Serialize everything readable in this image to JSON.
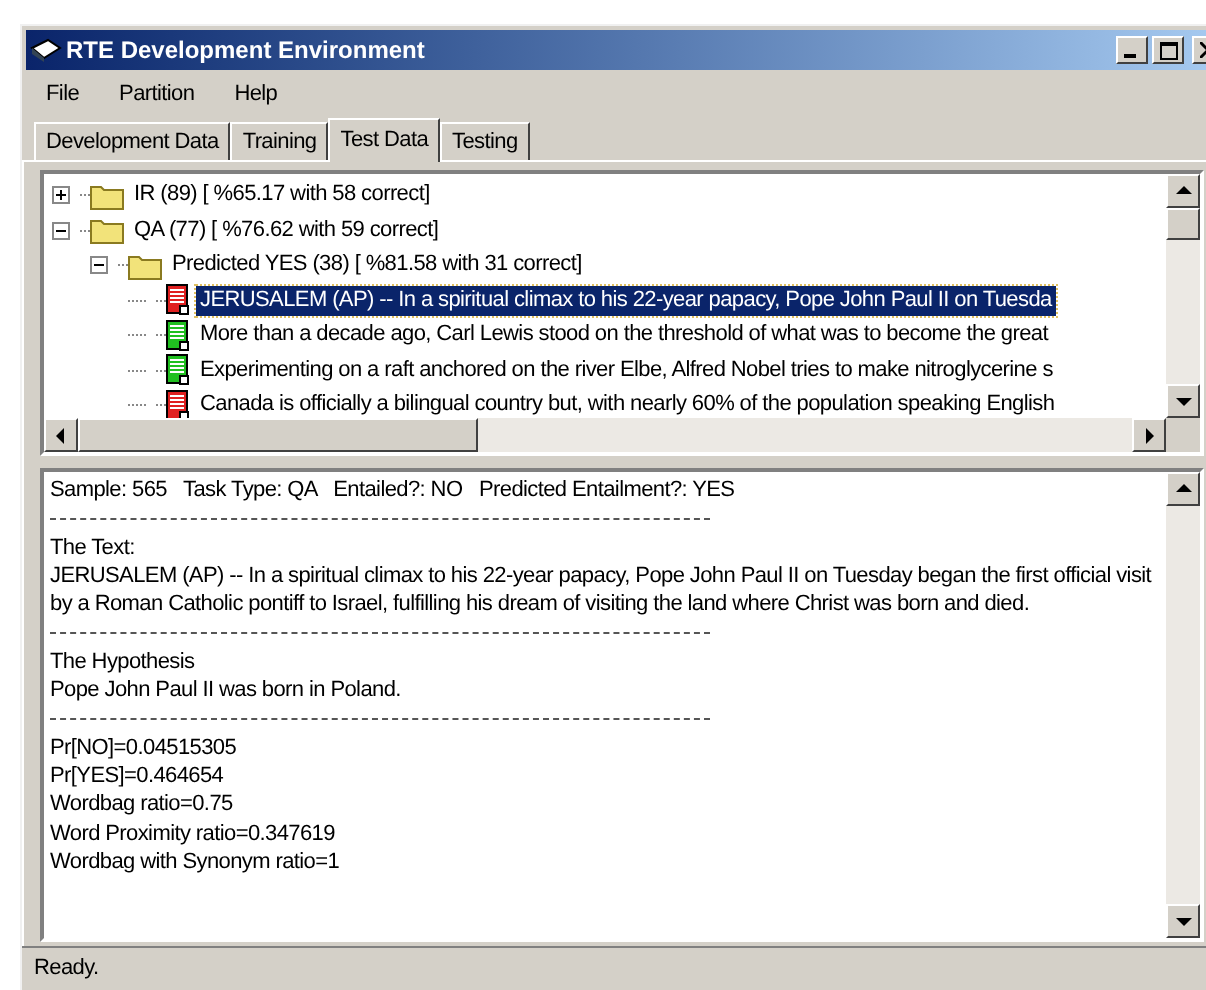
{
  "window": {
    "title": "RTE Development Environment"
  },
  "menu": [
    "File",
    "Partition",
    "Help"
  ],
  "tabs": [
    {
      "label": "Development Data",
      "selected": false
    },
    {
      "label": "Training",
      "selected": false
    },
    {
      "label": "Test Data",
      "selected": true
    },
    {
      "label": "Testing",
      "selected": false
    }
  ],
  "tree": [
    {
      "kind": "folder",
      "label": "IR (89) [  %65.17  with 58 correct]",
      "expanded": false,
      "selected": false
    },
    {
      "kind": "folder",
      "label": "QA (77) [  %76.62  with 59 correct]",
      "expanded": true,
      "selected": false,
      "children": [
        {
          "kind": "folder",
          "label": "Predicted YES (38) [  %81.58  with 31 correct]",
          "expanded": true,
          "selected": false,
          "children": [
            {
              "kind": "doc",
              "color": "#e02020",
              "label": "JERUSALEM (AP) -- In a spiritual climax to his 22-year papacy, Pope John Paul II on Tuesda",
              "selected": true
            },
            {
              "kind": "doc",
              "color": "#20c020",
              "label": "More than a decade ago, Carl Lewis stood on the threshold of what was to become the great",
              "selected": false
            },
            {
              "kind": "doc",
              "color": "#20c020",
              "label": "Experimenting on a raft anchored on the river Elbe, Alfred Nobel tries to make nitroglycerine s",
              "selected": false
            },
            {
              "kind": "doc",
              "color": "#e02020",
              "label": "Canada is officially a bilingual country but, with nearly 60% of the population speaking English",
              "selected": false
            }
          ]
        }
      ]
    }
  ],
  "details": [
    {
      "kind": "text",
      "text": "Sample: 565   Task Type: QA   Entailed?: NO   Predicted Entailment?: YES"
    },
    {
      "kind": "rule"
    },
    {
      "kind": "text",
      "text": "The Text:"
    },
    {
      "kind": "text",
      "text": "JERUSALEM (AP) -- In a spiritual climax to his 22-year papacy, Pope John Paul II on Tuesday began the first official visit by a Roman Catholic pontiff to Israel, fulfilling his dream of visiting the land where Christ was born and died."
    },
    {
      "kind": "rule"
    },
    {
      "kind": "text",
      "text": "The Hypothesis"
    },
    {
      "kind": "text",
      "text": "Pope John Paul II was born in Poland."
    },
    {
      "kind": "rule"
    },
    {
      "kind": "text",
      "text": "Pr[NO]=0.04515305"
    },
    {
      "kind": "text",
      "text": "Pr[YES]=0.464654"
    },
    {
      "kind": "text",
      "text": "Wordbag ratio=0.75"
    },
    {
      "kind": "text",
      "text": "Word Proximity ratio=0.347619"
    },
    {
      "kind": "text",
      "text": "Wordbag with Synonym ratio=1"
    }
  ],
  "status_bar": "Ready."
}
